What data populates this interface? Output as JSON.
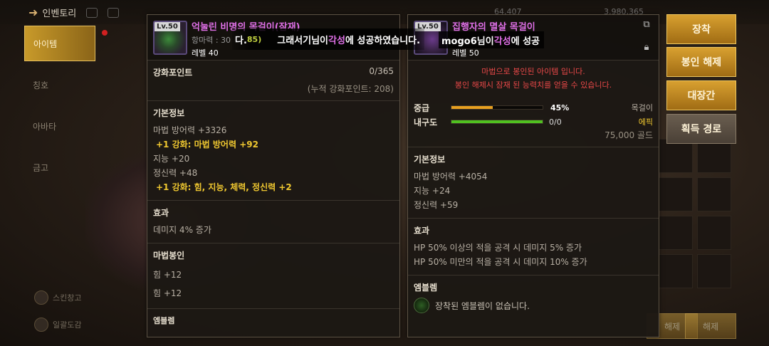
{
  "topbar": {
    "title": "인벤토리",
    "currency1": "64,407",
    "currency2": "3,980,365"
  },
  "sidebar": {
    "items": [
      {
        "label": "아이템"
      },
      {
        "label": "칭호"
      },
      {
        "label": "아바타"
      },
      {
        "label": "금고"
      }
    ],
    "bottom": [
      {
        "label": "스킨창고"
      },
      {
        "label": "일괄도감"
      }
    ]
  },
  "notice": {
    "prefix": "다.",
    "tag": "85)",
    "part1": "그래서기님이 ",
    "highlight": "각성",
    "part2": "에 성공하였습니다.",
    "second_user": "mogo6님이 ",
    "second_highlight": "각성",
    "second_tail": "에 성공"
  },
  "left_panel": {
    "level_badge": "Lv.50",
    "name": "억눌린 비명의 목걸이(잠재)",
    "sub": "항마력 : 30",
    "level": "레벨 40",
    "enhance_title": "강화포인트",
    "enhance_value": "0/365",
    "enhance_accum": "(누적 강화포인트: 208)",
    "basic_title": "기본정보",
    "basic_stats": [
      {
        "text": "마법 방어력 +3326",
        "gold": false
      },
      {
        "text": "+1 강화: 마법 방어력 +92",
        "gold": true
      },
      {
        "text": "지능 +20",
        "gold": false
      },
      {
        "text": "정신력 +48",
        "gold": false
      },
      {
        "text": "+1 강화: 힘, 지능, 체력, 정신력 +2",
        "gold": true
      }
    ],
    "effect_title": "효과",
    "effect_text": "데미지 4% 증가",
    "seal_title": "마법봉인",
    "seal_stats": [
      "힘 +12",
      "힘 +12"
    ],
    "emblem_title": "엠블렘"
  },
  "right_panel": {
    "level_badge": "Lv.50",
    "name": "집행자의 멸살 목걸이",
    "level": "레벨 50",
    "seal_warning_1": "마법으로 봉인된 아이템 입니다.",
    "seal_warning_2": "봉인 해제시 잠재 된 능력치를 얻을 수 있습니다.",
    "grade_label": "중급",
    "grade_value": "45%",
    "grade_fraction": 0.45,
    "durability_label": "내구도",
    "durability_value": "0/0",
    "durability_fraction": 1.0,
    "item_type": "목걸이",
    "rarity": "에픽",
    "price": "75,000 골드",
    "basic_title": "기본정보",
    "basic_stats": [
      "마법 방어력 +4054",
      "지능 +24",
      "정신력 +59"
    ],
    "effect_title": "효과",
    "effect_stats": [
      "HP 50% 이상의 적을 공격 시 데미지 5% 증가",
      "HP 50% 미만의 적을 공격 시 데미지 10% 증가"
    ],
    "emblem_title": "엠블렘",
    "emblem_text": "장착된 엠블렘이 없습니다."
  },
  "actions": {
    "equip": "장착",
    "unseal": "봉인 해제",
    "smith": "대장간",
    "source": "획득 경로"
  },
  "bottom_buttons": [
    "해제",
    "해제"
  ],
  "colors": {
    "epic": "#f0c830",
    "item_name": "#e070e8",
    "warning": "#e84848",
    "grade_bar": "#e8a020",
    "durability_bar": "#50c020",
    "button": "#c08a24"
  },
  "icons": {
    "back": "arrow-left-icon",
    "edit": "share-icon",
    "lock": "lock-icon"
  }
}
